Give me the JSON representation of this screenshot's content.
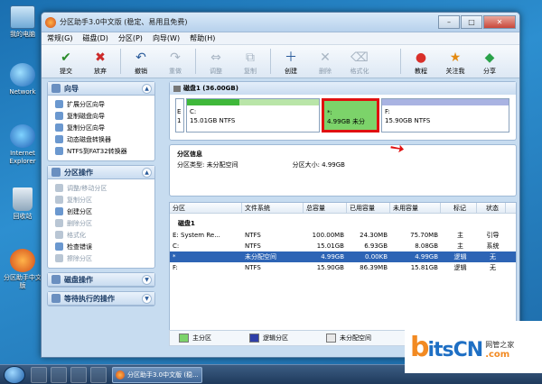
{
  "desktop": {
    "icons": [
      "我的电脑",
      "Network",
      "Internet Explorer",
      "回收站",
      "分区助手中文版"
    ]
  },
  "window": {
    "title": "分区助手3.0中文版 (稳定、易用且免费)",
    "menu": [
      "常规(G)",
      "磁盘(D)",
      "分区(P)",
      "向导(W)",
      "帮助(H)"
    ],
    "toolbar": [
      {
        "label": "提交",
        "icon": "✔"
      },
      {
        "label": "放弃",
        "icon": "✖"
      },
      {
        "label": "撤销",
        "icon": "↶"
      },
      {
        "label": "重做",
        "icon": "↷"
      },
      {
        "label": "调整",
        "icon": "⇔"
      },
      {
        "label": "复制",
        "icon": "⧉"
      },
      {
        "label": "创建",
        "icon": "＋"
      },
      {
        "label": "删除",
        "icon": "✕"
      },
      {
        "label": "格式化",
        "icon": "⌫"
      },
      {
        "label": "教程",
        "icon": "●"
      },
      {
        "label": "关注我",
        "icon": "★"
      },
      {
        "label": "分享",
        "icon": "◆"
      }
    ]
  },
  "wizard": {
    "title": "向导",
    "items": [
      "扩展分区向导",
      "复制磁盘向导",
      "复制分区向导",
      "动态磁盘转换器",
      "NTFS到FAT32转换器"
    ]
  },
  "partops": {
    "title": "分区操作",
    "items": [
      "调整/移动分区",
      "复制分区",
      "创建分区",
      "删除分区",
      "格式化",
      "检查错误",
      "擦除分区"
    ]
  },
  "diskops": {
    "title": "磁盘操作"
  },
  "pending": {
    "title": "等待执行的操作"
  },
  "disk": {
    "header": "磁盘1 (36.00GB)",
    "small_box": "E\n1",
    "c_part": {
      "name": "C:",
      "detail": "15.01GB NTFS"
    },
    "unalloc": {
      "name": "*:",
      "detail": "4.99GB 未分"
    },
    "f_part": {
      "name": "F:",
      "detail": "15.90GB NTFS"
    }
  },
  "info": {
    "title": "分区信息",
    "type_label": "分区类型: 未分配空间",
    "size_label": "分区大小: 4.99GB"
  },
  "table": {
    "columns": [
      "分区",
      "文件系统",
      "总容量",
      "已用容量",
      "未用容量",
      "标记",
      "状态"
    ],
    "group": "磁盘1",
    "rows": [
      [
        "E: System Re...",
        "NTFS",
        "100.00MB",
        "24.30MB",
        "75.70MB",
        "主",
        "引导"
      ],
      [
        "C:",
        "NTFS",
        "15.01GB",
        "6.93GB",
        "8.08GB",
        "主",
        "系统"
      ],
      [
        "*",
        "未分配空间",
        "4.99GB",
        "0.00KB",
        "4.99GB",
        "逻辑",
        "无"
      ],
      [
        "F:",
        "NTFS",
        "15.90GB",
        "86.39MB",
        "15.81GB",
        "逻辑",
        "无"
      ]
    ]
  },
  "legend": [
    "主分区",
    "逻辑分区",
    "未分配空间"
  ],
  "taskbar": {
    "app": "分区助手3.0中文版 (稳..."
  },
  "watermark": {
    "b": "b",
    "rest": "itsCN",
    "cn": "网管之家",
    "com": ".com"
  },
  "colors": {
    "primary": "#7cd36a",
    "logical": "#2f3fa8",
    "unalloc": "#e8e8e8",
    "selected": "#2d64b5",
    "highlight": "#e01010"
  }
}
